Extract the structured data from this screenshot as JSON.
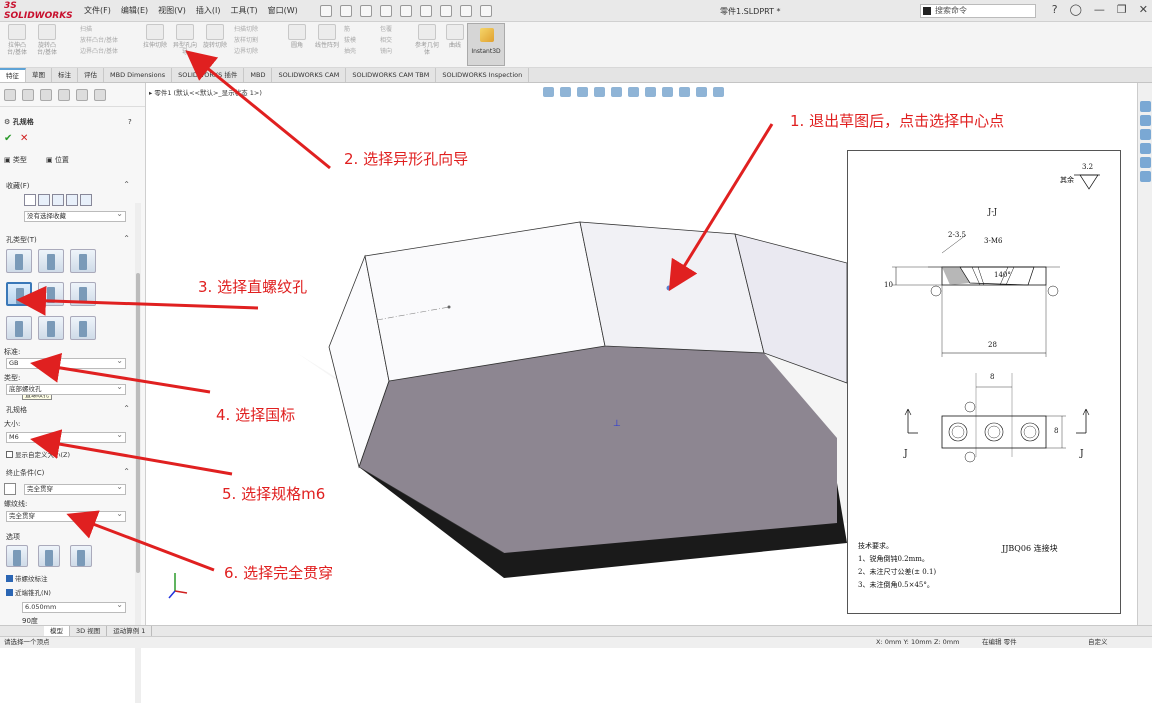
{
  "app": {
    "logo": "3S SOLIDWORKS",
    "document_title": "零件1.SLDPRT *"
  },
  "menu": [
    "文件(F)",
    "编辑(E)",
    "视图(V)",
    "插入(I)",
    "工具(T)",
    "窗口(W)"
  ],
  "search": {
    "placeholder": "搜索命令"
  },
  "ribbon": {
    "extrude_boss": "拉伸凸台/基体",
    "revolve_boss": "旋转凸台/基体",
    "sweep": "扫描",
    "loft": "放样凸台/基体",
    "boundary": "边界凸台/基体",
    "extrude_cut": "拉伸切除",
    "hole_wizard": "异型孔向导",
    "revolve_cut": "旋转切除",
    "sweep_cut": "扫描切除",
    "loft_cut": "放样切割",
    "boundary_cut": "边界切除",
    "fillet": "圆角",
    "linear_pattern": "线性阵列",
    "rib": "筋",
    "draft": "拔模",
    "shell": "抽壳",
    "wrap": "包覆",
    "intersect": "相交",
    "mirror": "镜向",
    "ref_geometry": "参考几何体",
    "curves": "曲线",
    "instant3d": "Instant3D"
  },
  "tabs": [
    "特征",
    "草图",
    "标注",
    "评估",
    "MBD Dimensions",
    "SOLIDWORKS 插件",
    "MBD",
    "SOLIDWORKS CAM",
    "SOLIDWORKS CAM TBM",
    "SOLIDWORKS Inspection"
  ],
  "property_manager": {
    "title": "孔规格",
    "help": "?",
    "ok": "✔",
    "cancel": "✕",
    "subtab_type": "类型",
    "subtab_position": "位置",
    "favorites_label": "收藏(F)",
    "favorites_value": "没有选择收藏",
    "hole_type_label": "孔类型(T)",
    "tooltip": "直螺纹孔",
    "standard_label": "标准:",
    "standard_value": "GB",
    "type_label": "类型:",
    "type_value": "底部螺纹孔",
    "hole_spec_label": "孔规格",
    "size_label": "大小:",
    "size_value": "M6",
    "custom_size": "显示自定义大小(Z)",
    "end_condition_label": "终止条件(C)",
    "end_condition_value": "完全贯穿",
    "thread_label": "螺纹线:",
    "thread_value": "完全贯穿",
    "options_label": "选项",
    "option_cosmetic": "带螺纹标注",
    "option_near_csk": "近端锥孔(N)",
    "dim_value": "6.050mm",
    "dim2_value": "90度"
  },
  "viewport": {
    "breadcrumb": "零件1 (默认<<默认>_显示状态 1>)"
  },
  "drawing": {
    "roughness_label": "其余",
    "roughness_value": "3.2",
    "section_title": "J-J",
    "dim_chamfer": "2-3.5",
    "dim_thread": "3-M6",
    "dim_angle": "140°",
    "dim_height": "10",
    "dim_width": "28",
    "dim_spacing": "8",
    "dim_depth": "8",
    "section_mark": "J",
    "tech_title": "技术要求。",
    "tech_line1": "1、锐角倒钝0.2mm。",
    "tech_line2": "2、未注尺寸公差(± 0.1)",
    "tech_line3": "3、未注倒角0.5×45°。",
    "part_name": "JJBQ06 连接块"
  },
  "annotations": {
    "step1": "1. 退出草图后，点击选择中心点",
    "step2": "2. 选择异形孔向导",
    "step3": "3. 选择直螺纹孔",
    "step4": "4. 选择国标",
    "step5": "5. 选择规格m6",
    "step6": "6. 选择完全贯穿"
  },
  "bottom_tabs": [
    "模型",
    "3D 视图",
    "运动算例 1"
  ],
  "status": {
    "left": "请选择一个顶点",
    "coords": "X: 0mm Y: 10mm Z: 0mm",
    "mode": "在编辑 零件",
    "units": "自定义"
  },
  "colors": {
    "accent_red": "#e02020",
    "brand_red": "#c8102e",
    "face_light": "#f6f6fa",
    "face_dark": "#8d8691"
  }
}
